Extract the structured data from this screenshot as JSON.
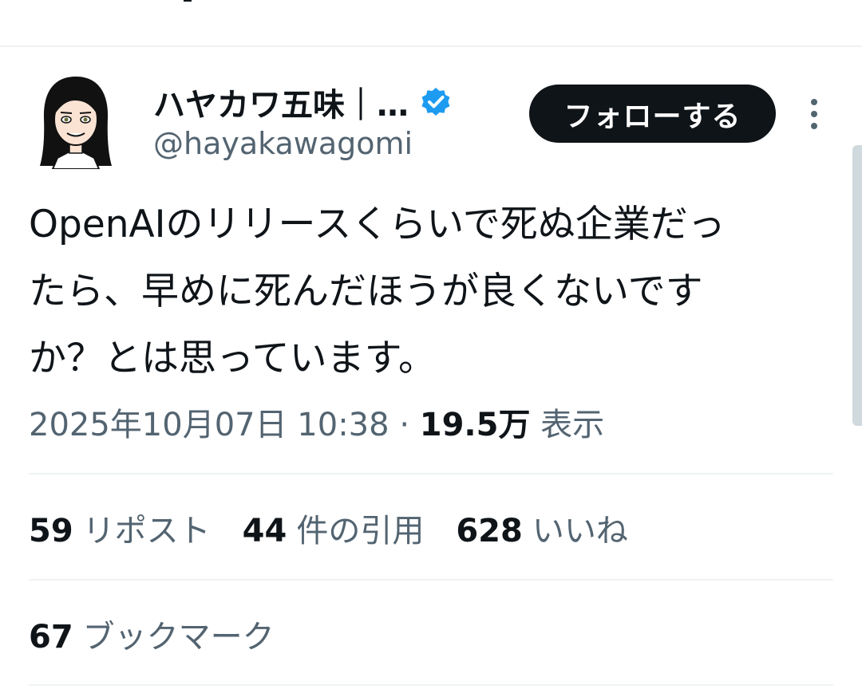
{
  "author": {
    "display_name": "ハヤカワ五味｜…",
    "handle": "@hayakawagomi",
    "verified": true
  },
  "follow_button_label": "フォローする",
  "tweet": {
    "text_lines": [
      "OpenAIのリリースくらいで死ぬ企業だっ",
      "たら、早めに死んだほうが良くないです",
      "か？とは思っています。"
    ]
  },
  "meta": {
    "timestamp": "2025年10月07日 10:38",
    "separator": "·",
    "views": "19.5万",
    "views_label": "表示"
  },
  "stats": {
    "reposts": {
      "count": "59",
      "label": "リポスト"
    },
    "quotes": {
      "count": "44",
      "label": "件の引用"
    },
    "likes": {
      "count": "628",
      "label": "いいね"
    },
    "bookmarks": {
      "count": "67",
      "label": "ブックマーク"
    }
  },
  "colors": {
    "text_primary": "#0f1419",
    "text_secondary": "#536471",
    "verified_blue": "#1d9bf0",
    "divider": "#eff3f4"
  },
  "icons": {
    "verified": "verified-badge-icon",
    "more": "more-vertical-icon"
  }
}
